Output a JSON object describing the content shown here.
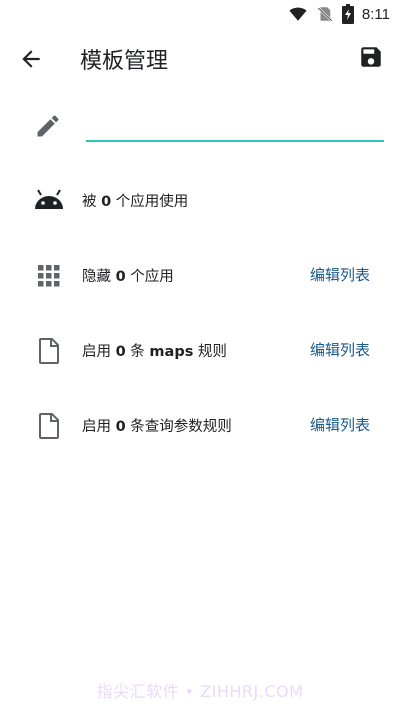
{
  "status_bar": {
    "time": "8:11"
  },
  "app_bar": {
    "title": "模板管理"
  },
  "name_field": {
    "value": "",
    "placeholder": ""
  },
  "rows": [
    {
      "prefix": "被 ",
      "count": "0",
      "suffix": " 个应用使用"
    },
    {
      "prefix": "隐藏 ",
      "count": "0",
      "suffix": " 个应用",
      "action": "编辑列表"
    },
    {
      "prefix": "启用 ",
      "count": "0",
      "suffix": " 条 ",
      "bold_suffix": "maps",
      "suffix2": " 规则",
      "action": "编辑列表"
    },
    {
      "prefix": "启用 ",
      "count": "0",
      "suffix": " 条查询参数规则",
      "action": "编辑列表"
    }
  ],
  "watermark": "指尖汇软件 • ZIHHRJ.COM",
  "colors": {
    "accent": "#2ec4b6",
    "link": "#1a5a8c",
    "icon": "#5f6368"
  }
}
